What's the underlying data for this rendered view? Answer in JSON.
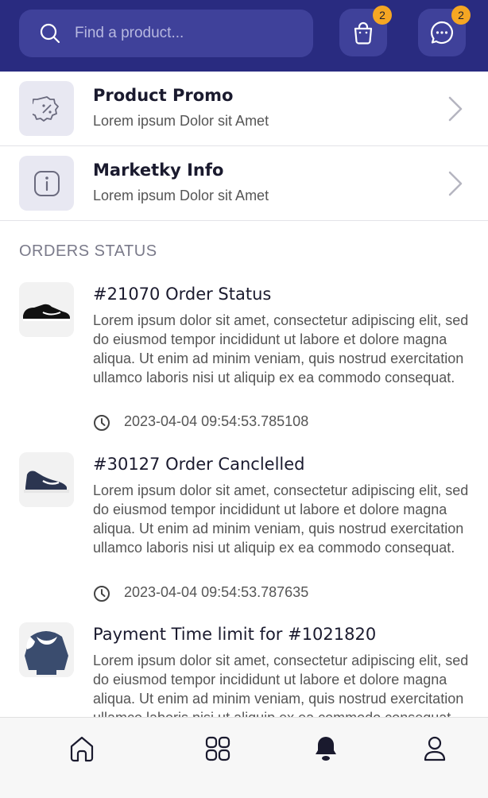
{
  "colors": {
    "header_bg": "#292b80",
    "header_btn": "#3f419a",
    "badge": "#f5a623"
  },
  "search": {
    "placeholder": "Find a product..."
  },
  "header": {
    "cart_badge": "2",
    "chat_badge": "2"
  },
  "menu": [
    {
      "icon": "discount-badge-icon",
      "title": "Product Promo",
      "subtitle": "Lorem ipsum Dolor sit Amet"
    },
    {
      "icon": "info-icon",
      "title": "Marketky Info",
      "subtitle": "Lorem ipsum Dolor sit Amet"
    }
  ],
  "orders_section": {
    "label": "ORDERS STATUS"
  },
  "orders": [
    {
      "thumb": "black-sneaker-image",
      "title": "#21070 Order Status",
      "body": "Lorem ipsum dolor sit amet, consectetur adipiscing elit, sed do eiusmod tempor incididunt ut labore et dolore magna aliqua. Ut enim ad minim veniam, quis nostrud exercitation ullamco laboris nisi ut aliquip ex ea commodo consequat.",
      "time": "2023-04-04 09:54:53.785108"
    },
    {
      "thumb": "navy-high-top-sneaker-image",
      "title": "#30127 Order Canclelled",
      "body": "Lorem ipsum dolor sit amet, consectetur adipiscing elit, sed do eiusmod tempor incididunt ut labore et dolore magna aliqua. Ut enim ad minim veniam, quis nostrud exercitation ullamco laboris nisi ut aliquip ex ea commodo consequat.",
      "time": "2023-04-04 09:54:53.787635"
    },
    {
      "thumb": "navy-hoodie-image",
      "title": "Payment Time limit for #1021820",
      "body": "Lorem ipsum dolor sit amet, consectetur adipiscing elit, sed do eiusmod tempor incididunt ut labore et dolore magna aliqua. Ut enim ad minim veniam, quis nostrud exercitation ullamco laboris nisi ut aliquip ex ea commodo consequat."
    }
  ],
  "bottom_nav": [
    {
      "icon": "home-icon",
      "active": false
    },
    {
      "icon": "grid-icon",
      "active": false
    },
    {
      "icon": "bell-icon",
      "active": true
    },
    {
      "icon": "user-icon",
      "active": false
    }
  ]
}
